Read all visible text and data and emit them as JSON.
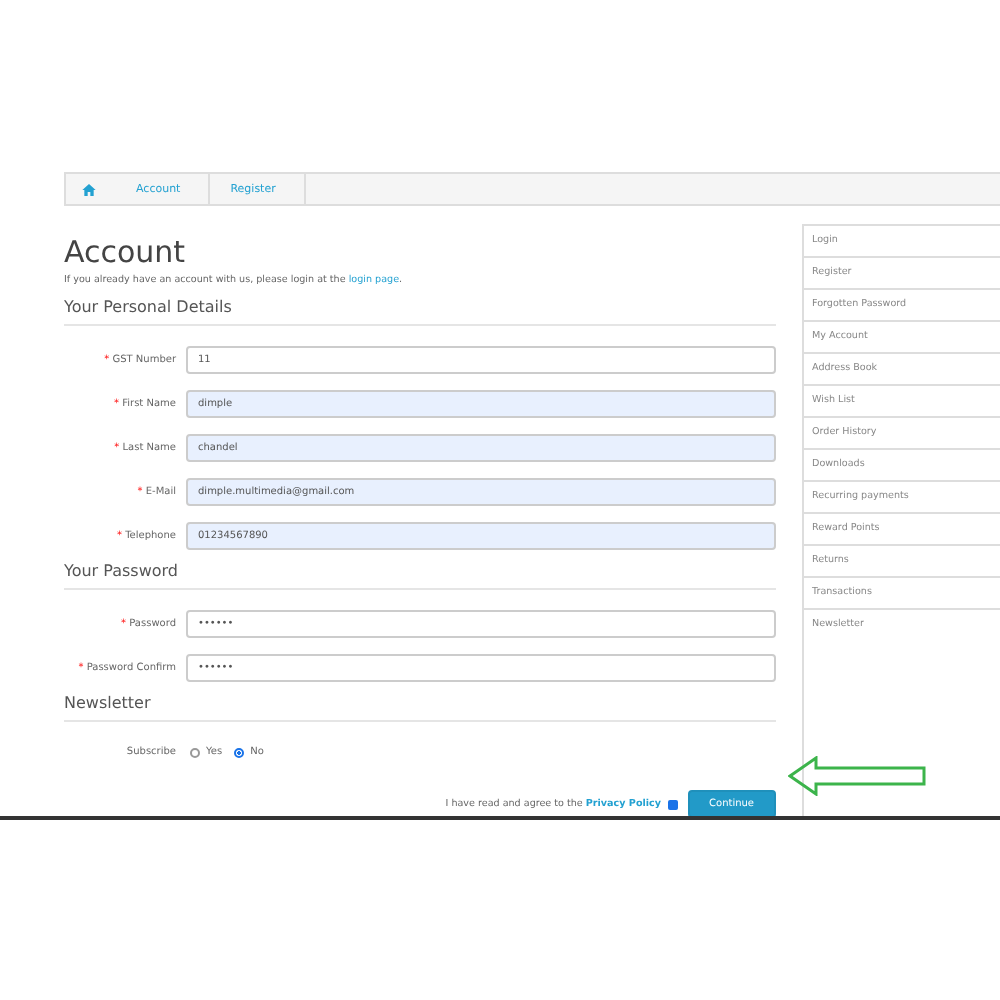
{
  "breadcrumb": [
    {
      "label": "Account"
    },
    {
      "label": "Register"
    }
  ],
  "title": "Account",
  "intro_end": ".",
  "intro_text": "If you already have an account with us, please login at the ",
  "intro_link": "login page",
  "sections": [
    {
      "heading": "Your Personal Details",
      "fields": [
        {
          "label": "GST Number",
          "marker": "*",
          "value": "11",
          "autofilled": false
        },
        {
          "label": "First Name",
          "marker": "*",
          "value": "dimple",
          "autofilled": true
        },
        {
          "label": "Last Name",
          "marker": "*",
          "value": "chandel",
          "autofilled": true
        },
        {
          "label": "E-Mail",
          "marker": "*",
          "value": "dimple.multimedia@gmail.com",
          "autofilled": true
        },
        {
          "label": "Telephone",
          "marker": "*",
          "value": "01234567890",
          "autofilled": true
        }
      ]
    },
    {
      "heading": "Your Password",
      "fields": [
        {
          "label": "Password",
          "marker": "*",
          "value": "••••••",
          "autofilled": false
        },
        {
          "label": "Password Confirm",
          "marker": "*",
          "value": "••••••",
          "autofilled": false
        }
      ]
    }
  ],
  "newsletter": {
    "heading": "Newsletter",
    "label": "Subscribe",
    "options": [
      {
        "label": "Yes",
        "selected": false
      },
      {
        "label": "No",
        "selected": true
      }
    ]
  },
  "agree": {
    "text": "I have read and agree to the ",
    "link": "Privacy Policy",
    "checked": true
  },
  "continue_button": "Continue",
  "sidebar": {
    "items": [
      {
        "label": "Login"
      },
      {
        "label": "Register"
      },
      {
        "label": "Forgotten Password"
      },
      {
        "label": "My Account"
      },
      {
        "label": "Address Book"
      },
      {
        "label": "Wish List"
      },
      {
        "label": "Order History"
      },
      {
        "label": "Downloads"
      },
      {
        "label": "Recurring payments"
      },
      {
        "label": "Reward Points"
      },
      {
        "label": "Returns"
      },
      {
        "label": "Transactions"
      },
      {
        "label": "Newsletter"
      }
    ]
  }
}
